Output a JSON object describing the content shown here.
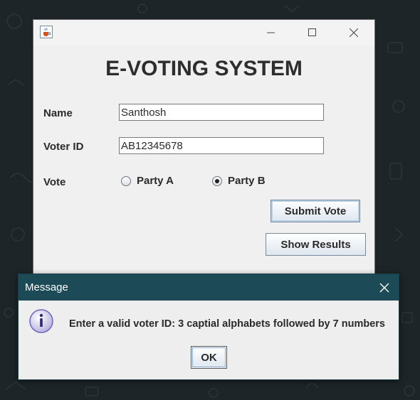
{
  "window": {
    "icon": "java-cup-icon",
    "app_title": "E-VOTING SYSTEM"
  },
  "form": {
    "name_label": "Name",
    "name_value": "Santhosh",
    "voter_id_label": "Voter ID",
    "voter_id_value": "AB12345678",
    "vote_label": "Vote",
    "options": [
      {
        "label": "Party A",
        "selected": false
      },
      {
        "label": "Party B",
        "selected": true
      }
    ],
    "submit_label": "Submit Vote",
    "results_label": "Show Results"
  },
  "dialog": {
    "title": "Message",
    "icon": "info-icon",
    "message": "Enter a valid voter ID: 3 captial alphabets followed by 7 numbers",
    "ok_label": "OK"
  },
  "colors": {
    "dialog_titlebar": "#1c4a57",
    "desktop": "#1d2528",
    "window_bg": "#f0f0f0"
  }
}
